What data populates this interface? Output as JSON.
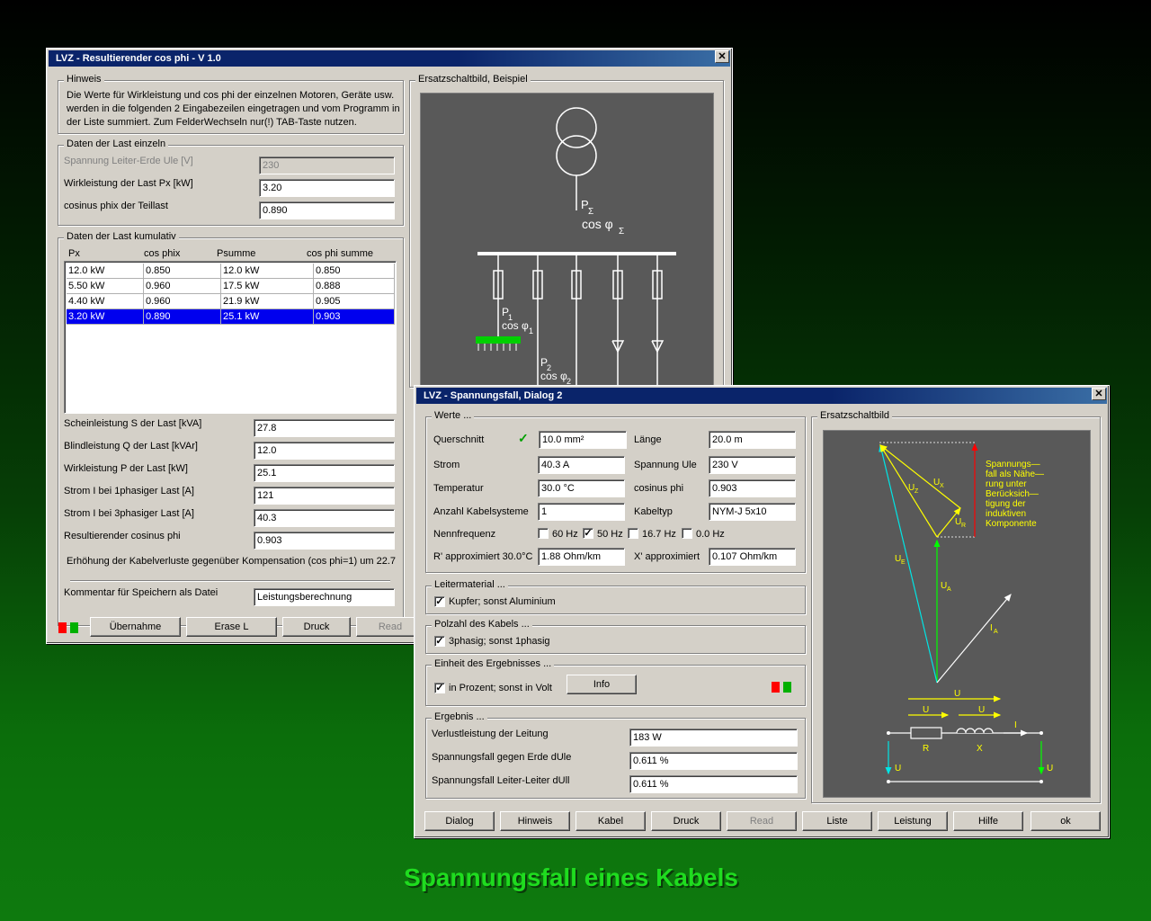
{
  "caption": "Spannungsfall eines Kabels",
  "win1": {
    "title": "LVZ - Resultierender cos phi - V 1.0",
    "hinweis": {
      "label": "Hinweis",
      "lines": [
        "Die Werte für Wirkleistung und cos phi der einzelnen Motoren, Geräte usw.",
        "werden in die folgenden 2 Eingabezeilen eingetragen und vom Programm in",
        "der Liste summiert. Zum FelderWechseln nur(!) TAB-Taste nutzen."
      ]
    },
    "einzeln": {
      "label": "Daten der Last einzeln",
      "spannung_label": "Spannung Leiter-Erde Ule [V]",
      "spannung_value": "230",
      "wirk_label": "Wirkleistung der Last Px [kW]",
      "wirk_value": "3.20",
      "cos_label": "cosinus phix der Teillast",
      "cos_value": "0.890"
    },
    "kumulativ": {
      "label": "Daten der Last kumulativ",
      "headers": [
        "Px",
        "cos phix",
        "Psumme",
        "cos phi summe"
      ],
      "rows": [
        [
          "12.0 kW",
          "0.850",
          "12.0 kW",
          "0.850"
        ],
        [
          "5.50 kW",
          "0.960",
          "17.5 kW",
          "0.888"
        ],
        [
          "4.40 kW",
          "0.960",
          "21.9 kW",
          "0.905"
        ],
        [
          "3.20 kW",
          "0.890",
          "25.1 kW",
          "0.903"
        ]
      ],
      "selected_row": 3
    },
    "results": [
      {
        "label": "Scheinleistung S der Last [kVA]",
        "value": "27.8"
      },
      {
        "label": "Blindleistung Q der Last  [kVAr]",
        "value": "12.0"
      },
      {
        "label": "Wirkleistung P der Last [kW]",
        "value": "25.1"
      },
      {
        "label": "Strom I bei 1phasiger Last [A]",
        "value": "121"
      },
      {
        "label": "Strom I bei 3phasiger Last [A]",
        "value": "40.3"
      },
      {
        "label": "Resultierender cosinus phi",
        "value": "0.903"
      }
    ],
    "erhoehung": "Erhöhung der Kabelverluste gegenüber Kompensation (cos phi=1) um 22.7 %",
    "kommentar_label": "Kommentar für Speichern als Datei",
    "kommentar_value": "Leistungsberechnung",
    "buttons": {
      "uebernahme": "Übernahme",
      "erase": "Erase L",
      "druck": "Druck",
      "read": "Read"
    },
    "ersatz": {
      "label": "Ersatzschaltbild, Beispiel",
      "p_sum": "P",
      "p_sum_sub": "Σ",
      "cos_sum": "cos φ",
      "cos_sum_sub": "Σ",
      "p1": "P",
      "p1_sub": "1",
      "cos1": "cos φ",
      "cos1_sub": "1",
      "p2": "P",
      "p2_sub": "2",
      "cos2": "cos φ",
      "cos2_sub": "2"
    }
  },
  "win2": {
    "title": "LVZ - Spannungsfall, Dialog 2",
    "werte": {
      "label": "Werte ...",
      "querschnitt_label": "Querschnitt",
      "querschnitt_value": "10.0 mm²",
      "laenge_label": "Länge",
      "laenge_value": "20.0 m",
      "strom_label": "Strom",
      "strom_value": "40.3 A",
      "spannung_label": "Spannung Ule",
      "spannung_value": "230 V",
      "temp_label": "Temperatur",
      "temp_value": "30.0 °C",
      "cos_label": "cosinus phi",
      "cos_value": "0.903",
      "anzahl_label": "Anzahl Kabelsysteme",
      "anzahl_value": "1",
      "kabeltyp_label": "Kabeltyp",
      "kabeltyp_value": "NYM-J 5x10",
      "nenn_label": "Nennfrequenz",
      "freq": [
        {
          "label": "60 Hz",
          "checked": false
        },
        {
          "label": "50 Hz",
          "checked": true
        },
        {
          "label": "16.7 Hz",
          "checked": false
        },
        {
          "label": "0.0 Hz",
          "checked": false
        }
      ],
      "r_label": "R' approximiert 30.0°C",
      "r_value": "1.88 Ohm/km",
      "x_label": "X' approximiert",
      "x_value": "0.107 Ohm/km"
    },
    "leiter": {
      "label": "Leitermaterial ...",
      "check": "Kupfer; sonst Aluminium",
      "checked": true
    },
    "pol": {
      "label": "Polzahl des Kabels ...",
      "check": "3phasig; sonst 1phasig",
      "checked": true
    },
    "einheit": {
      "label": "Einheit des Ergebnisses ...",
      "check": "in Prozent; sonst in Volt",
      "checked": true,
      "info_button": "Info"
    },
    "ergebnis": {
      "label": "Ergebnis ...",
      "items": [
        {
          "label": "Verlustleistung der Leitung",
          "value": "183 W"
        },
        {
          "label": "Spannungsfall gegen Erde dUle",
          "value": "0.611 %"
        },
        {
          "label": "Spannungsfall Leiter-Leiter dUll",
          "value": "0.611 %"
        }
      ]
    },
    "ersatz": {
      "label": "Ersatzschaltbild",
      "note": [
        "Spannungs—",
        "fall als Nähe—",
        "rung unter",
        "Berücksich—",
        "tigung der",
        "induktiven",
        "Komponente"
      ],
      "ux": "U",
      "ux_sub": "X",
      "uz": "U",
      "uz_sub": "Z",
      "ur": "U",
      "ur_sub": "R",
      "ue": "U",
      "ue_sub": "E",
      "ua": "U",
      "ua_sub": "A",
      "ia": "I",
      "ia_sub": "A",
      "r": "R",
      "x": "X"
    },
    "buttons": [
      "Dialog",
      "Hinweis",
      "Kabel",
      "Druck",
      "Read",
      "Liste",
      "Leistung",
      "Hilfe",
      "ok"
    ],
    "disabled_button": "Read"
  },
  "colors": {
    "title_bar": "#0a246a",
    "selection": "#0000ee",
    "caption": "#1fdc1f",
    "diagram_bg": "#595959",
    "diagram_yellow": "#ffff00",
    "diagram_cyan": "#00e5e5",
    "diagram_green": "#00ff00",
    "diagram_red": "#ff0000"
  }
}
